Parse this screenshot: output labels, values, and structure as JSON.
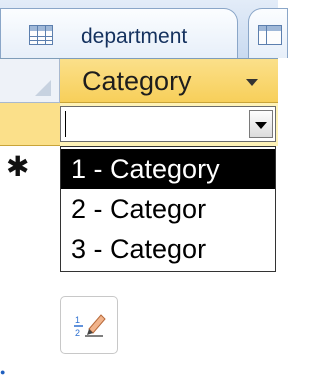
{
  "tab": {
    "label": "department",
    "icon": "table-icon"
  },
  "tab2": {
    "icon": "table-icon"
  },
  "column": {
    "header": "Category",
    "filter_icon": "chevron-down-icon"
  },
  "combo": {
    "value": "",
    "button_icon": "chevron-down-icon"
  },
  "new_record_marker": "✱",
  "dropdown": {
    "options": [
      "1 - Category",
      "2 - Categor",
      "3 - Categor"
    ],
    "selected_index": 0
  },
  "toolbar": {
    "totals_icon": "totals-icon"
  },
  "colors": {
    "header_accent": "#f7cf5a",
    "selection": "#000000",
    "tab_text": "#14315e"
  }
}
